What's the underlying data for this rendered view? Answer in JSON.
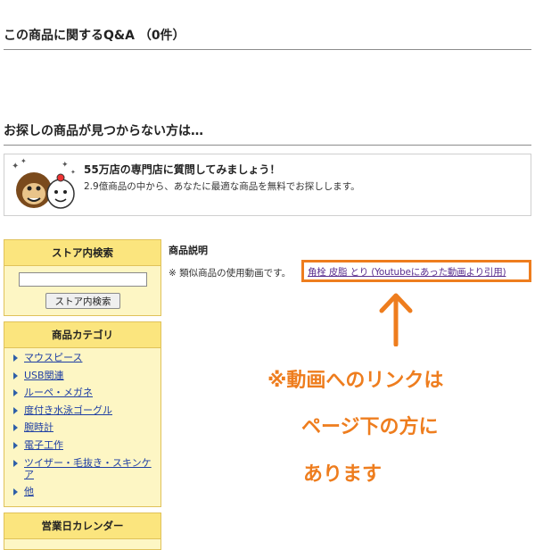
{
  "qa": {
    "heading": "この商品に関するQ&A （0件）"
  },
  "not_found": {
    "heading": "お探しの商品が見つからない方は…"
  },
  "promo": {
    "title": "55万店の専門店に質問してみましょう！",
    "description": "2.9億商品の中から、あなたに最適な商品を無料でお探しします。"
  },
  "sidebar": {
    "search": {
      "header": "ストア内検索",
      "input_value": "",
      "button": "ストア内検索"
    },
    "categories": {
      "header": "商品カテゴリ",
      "items": [
        "マウスピース",
        "USB関連",
        "ルーペ・メガネ",
        "度付き水泳ゴーグル",
        "腕時計",
        "電子工作",
        "ツイザー・毛抜き・スキンケア",
        "他"
      ]
    },
    "calendar": {
      "header": "営業日カレンダー"
    }
  },
  "main": {
    "section_label": "商品説明",
    "note": "※ 類似商品の使用動画です。",
    "video_link": "角栓 皮脂 とり (Youtubeにあった動画より引用)"
  },
  "annotation": {
    "lines": [
      "※動画へのリンクは",
      "ページ下の方に",
      "あります"
    ],
    "color": "#ee7d1e"
  }
}
